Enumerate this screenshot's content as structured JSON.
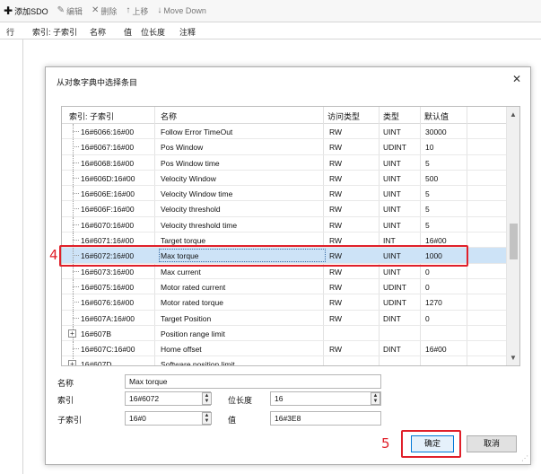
{
  "toolbar": {
    "add_label": "添加SDO",
    "edit_label": "编辑",
    "delete_label": "删除",
    "up_label": "上移",
    "down_label": "Move Down"
  },
  "grid": {
    "headers": [
      "行",
      "索引: 子索引",
      "名称",
      "值",
      "位长度",
      "注释"
    ]
  },
  "dialog": {
    "title": "从对象字典中选择条目",
    "close_label": "✕",
    "columns": [
      "索引: 子索引",
      "名称",
      "访问类型",
      "类型",
      "默认值"
    ],
    "rows": [
      {
        "index": "16#6066:16#00",
        "name": "Follow Error TimeOut",
        "access": "RW",
        "type": "UINT",
        "default": "30000",
        "expander": false
      },
      {
        "index": "16#6067:16#00",
        "name": "Pos Window",
        "access": "RW",
        "type": "UDINT",
        "default": "10",
        "expander": false
      },
      {
        "index": "16#6068:16#00",
        "name": "Pos Window time",
        "access": "RW",
        "type": "UINT",
        "default": "5",
        "expander": false
      },
      {
        "index": "16#606D:16#00",
        "name": "Velocity Window",
        "access": "RW",
        "type": "UINT",
        "default": "500",
        "expander": false
      },
      {
        "index": "16#606E:16#00",
        "name": "Velocity Window time",
        "access": "RW",
        "type": "UINT",
        "default": "5",
        "expander": false
      },
      {
        "index": "16#606F:16#00",
        "name": "Velocity threshold",
        "access": "RW",
        "type": "UINT",
        "default": "5",
        "expander": false
      },
      {
        "index": "16#6070:16#00",
        "name": "Velocity threshold time",
        "access": "RW",
        "type": "UINT",
        "default": "5",
        "expander": false
      },
      {
        "index": "16#6071:16#00",
        "name": "Target torque",
        "access": "RW",
        "type": "INT",
        "default": "16#00",
        "expander": false
      },
      {
        "index": "16#6072:16#00",
        "name": "Max torque",
        "access": "RW",
        "type": "UINT",
        "default": "1000",
        "expander": false,
        "selected": true
      },
      {
        "index": "16#6073:16#00",
        "name": "Max current",
        "access": "RW",
        "type": "UINT",
        "default": "0",
        "expander": false
      },
      {
        "index": "16#6075:16#00",
        "name": "Motor rated current",
        "access": "RW",
        "type": "UDINT",
        "default": "0",
        "expander": false
      },
      {
        "index": "16#6076:16#00",
        "name": "Motor rated torque",
        "access": "RW",
        "type": "UDINT",
        "default": "1270",
        "expander": false
      },
      {
        "index": "16#607A:16#00",
        "name": "Target Position",
        "access": "RW",
        "type": "DINT",
        "default": "0",
        "expander": false
      },
      {
        "index": "16#607B",
        "name": "Position range limit",
        "access": "",
        "type": "",
        "default": "",
        "expander": true
      },
      {
        "index": "16#607C:16#00",
        "name": "Home offset",
        "access": "RW",
        "type": "DINT",
        "default": "16#00",
        "expander": false
      },
      {
        "index": "16#607D",
        "name": "Software position limit",
        "access": "",
        "type": "",
        "default": "",
        "expander": true
      }
    ],
    "step4_label": "4",
    "step5_label": "5",
    "form": {
      "name_label": "名称",
      "name_value": "Max torque",
      "index_label": "索引",
      "index_value": "16#6072",
      "bitlen_label": "位长度",
      "bitlen_value": "16",
      "subindex_label": "子索引",
      "subindex_value": "16#0",
      "value_label": "值",
      "value_value": "16#3E8"
    },
    "ok_label": "确定",
    "cancel_label": "取消"
  },
  "colors": {
    "selection": "#cde3f7",
    "highlight_red": "#e0202a",
    "primary_border": "#0078d7"
  }
}
